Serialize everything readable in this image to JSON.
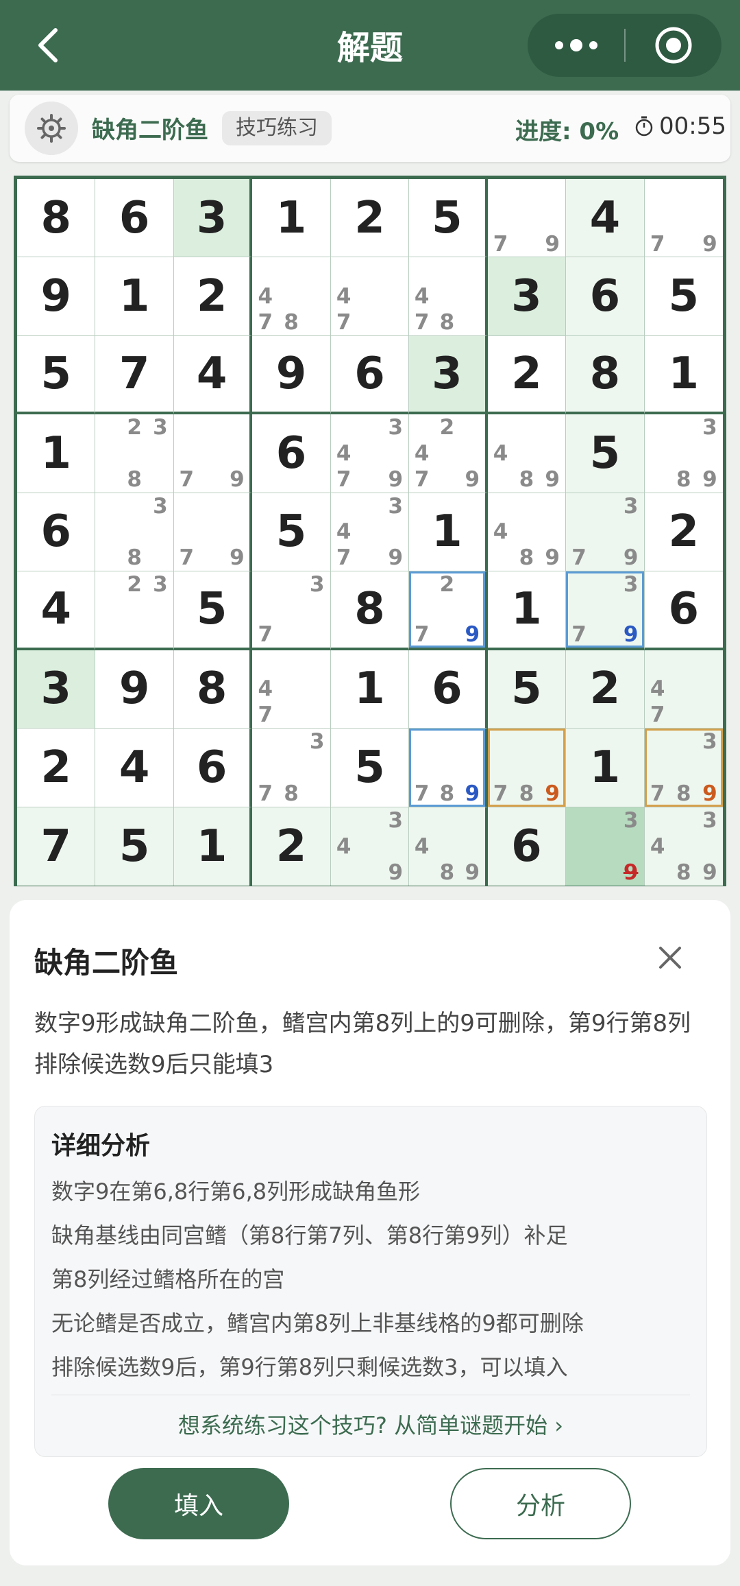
{
  "header": {
    "title": "解题",
    "back_icon": "chevron-left-icon",
    "more_icon": "more-dots-icon",
    "close_icon": "target-circle-icon"
  },
  "info": {
    "technique_name": "缺角二阶鱼",
    "tag": "技巧练习",
    "progress": "进度: 0%",
    "timer": "00:55",
    "settings_icon": "gear-icon",
    "timer_icon": "stopwatch-icon"
  },
  "colors": {
    "primary": "#3c6b50",
    "highlight": "#dcefdf",
    "light_highlight": "#eef7ef",
    "selected_cell": "#b7dbbf",
    "blue_border": "#5b9bd5",
    "orange_border": "#d4a04c",
    "blue_digit": "#2b59c3",
    "orange_digit": "#cc5a1e",
    "eliminated_digit": "#c62828"
  },
  "board": {
    "rows": [
      [
        {
          "v": "8"
        },
        {
          "v": "6"
        },
        {
          "v": "3"
        },
        {
          "v": "1"
        },
        {
          "v": "2"
        },
        {
          "v": "5"
        },
        {
          "c": [
            7,
            9
          ]
        },
        {
          "v": "4"
        },
        {
          "c": [
            7,
            9
          ]
        }
      ],
      [
        {
          "v": "9"
        },
        {
          "v": "1"
        },
        {
          "v": "2"
        },
        {
          "c": [
            4,
            7,
            8
          ]
        },
        {
          "c": [
            4,
            7
          ]
        },
        {
          "c": [
            4,
            7,
            8
          ]
        },
        {
          "v": "3"
        },
        {
          "v": "6"
        },
        {
          "v": "5"
        }
      ],
      [
        {
          "v": "5"
        },
        {
          "v": "7"
        },
        {
          "v": "4"
        },
        {
          "v": "9"
        },
        {
          "v": "6"
        },
        {
          "v": "3"
        },
        {
          "v": "2"
        },
        {
          "v": "8"
        },
        {
          "v": "1"
        }
      ],
      [
        {
          "v": "1"
        },
        {
          "c": [
            2,
            3,
            8
          ]
        },
        {
          "c": [
            7,
            9
          ]
        },
        {
          "v": "6"
        },
        {
          "c": [
            3,
            4,
            7,
            9
          ]
        },
        {
          "c": [
            2,
            4,
            7,
            9
          ]
        },
        {
          "c": [
            4,
            8,
            9
          ]
        },
        {
          "v": "5"
        },
        {
          "c": [
            3,
            8,
            9
          ]
        }
      ],
      [
        {
          "v": "6"
        },
        {
          "c": [
            3,
            8
          ]
        },
        {
          "c": [
            7,
            9
          ]
        },
        {
          "v": "5"
        },
        {
          "c": [
            3,
            4,
            7,
            9
          ]
        },
        {
          "v": "1"
        },
        {
          "c": [
            4,
            8,
            9
          ]
        },
        {
          "c": [
            3,
            7,
            9
          ]
        },
        {
          "v": "2"
        }
      ],
      [
        {
          "v": "4"
        },
        {
          "c": [
            2,
            3
          ]
        },
        {
          "v": "5"
        },
        {
          "c": [
            3,
            7
          ]
        },
        {
          "v": "8"
        },
        {
          "c": [
            2,
            7,
            9
          ],
          "blue": [
            9
          ]
        },
        {
          "v": "1"
        },
        {
          "c": [
            3,
            7,
            9
          ],
          "blue": [
            9
          ]
        },
        {
          "v": "6"
        }
      ],
      [
        {
          "v": "3"
        },
        {
          "v": "9"
        },
        {
          "v": "8"
        },
        {
          "c": [
            4,
            7
          ]
        },
        {
          "v": "1"
        },
        {
          "v": "6"
        },
        {
          "v": "5"
        },
        {
          "v": "2"
        },
        {
          "c": [
            4,
            7
          ]
        }
      ],
      [
        {
          "v": "2"
        },
        {
          "v": "4"
        },
        {
          "v": "6"
        },
        {
          "c": [
            3,
            7,
            8
          ]
        },
        {
          "v": "5"
        },
        {
          "c": [
            7,
            8,
            9
          ],
          "blue": [
            9
          ]
        },
        {
          "c": [
            7,
            8,
            9
          ],
          "orange": [
            9
          ]
        },
        {
          "v": "1"
        },
        {
          "c": [
            3,
            7,
            8,
            9
          ],
          "orange": [
            9
          ]
        }
      ],
      [
        {
          "v": "7"
        },
        {
          "v": "5"
        },
        {
          "v": "1"
        },
        {
          "v": "2"
        },
        {
          "c": [
            3,
            4,
            9
          ]
        },
        {
          "c": [
            4,
            8,
            9
          ]
        },
        {
          "v": "6"
        },
        {
          "c": [
            3,
            9
          ],
          "strike": [
            9
          ]
        },
        {
          "c": [
            3,
            4,
            8,
            9
          ]
        }
      ]
    ]
  },
  "panel": {
    "title": "缺角二阶鱼",
    "close_icon": "close-icon",
    "description": "数字9形成缺角二阶鱼，鳍宫内第8列上的9可删除，第9行第8列排除候选数9后只能填3",
    "detail_title": "详细分析",
    "detail_lines": [
      "数字9在第6,8行第6,8列形成缺角鱼形",
      "缺角基线由同宫鳍（第8行第7列、第8行第9列）补足",
      "第8列经过鳍格所在的宫",
      "无论鳍是否成立，鳍宫内第8列上非基线格的9都可删除",
      "排除候选数9后，第9行第8列只剩候选数3，可以填入"
    ],
    "practice_link": "想系统练习这个技巧? 从简单谜题开始 ›",
    "fill_button": "填入",
    "analyze_button": "分析"
  }
}
